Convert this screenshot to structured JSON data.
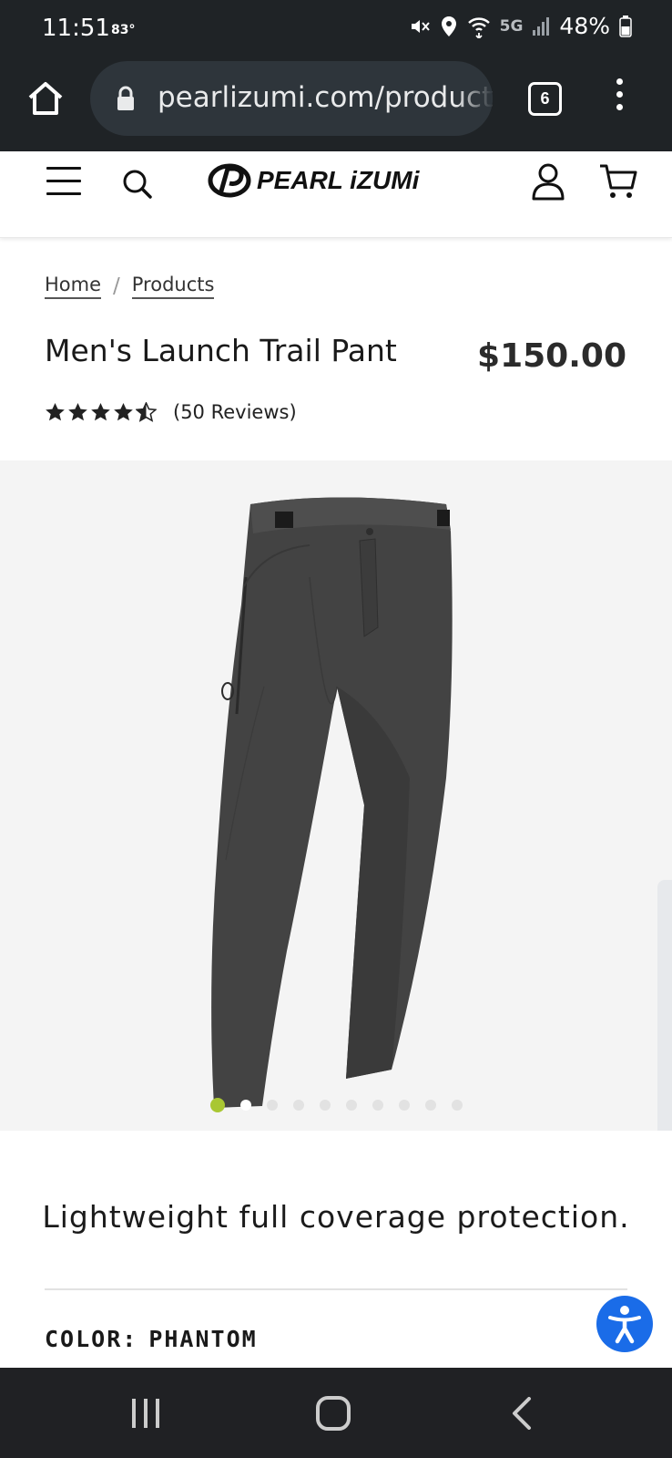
{
  "status_bar": {
    "time": "11:51",
    "temperature": "83°",
    "network": "5G",
    "battery": "48%"
  },
  "browser": {
    "url": "pearlizumi.com/products",
    "tab_count": "6"
  },
  "header": {
    "logo_text": "PEARL iZUMi"
  },
  "breadcrumb": {
    "home": "Home",
    "separator": "/",
    "products": "Products"
  },
  "product": {
    "title": "Men's Launch Trail Pant",
    "price": "$150.00",
    "rating_value": 4.5,
    "rating_max": 5,
    "reviews": "(50 Reviews)",
    "tagline": "Lightweight full coverage protection.",
    "color_label": "COLOR:",
    "color_value": "PHANTOM"
  },
  "gallery": {
    "image_count": 10,
    "active_index": 0,
    "accent_color": "#a9c733"
  },
  "colors": {
    "status_bg": "#1f2326",
    "accessibility_button": "#1a6ce8"
  }
}
